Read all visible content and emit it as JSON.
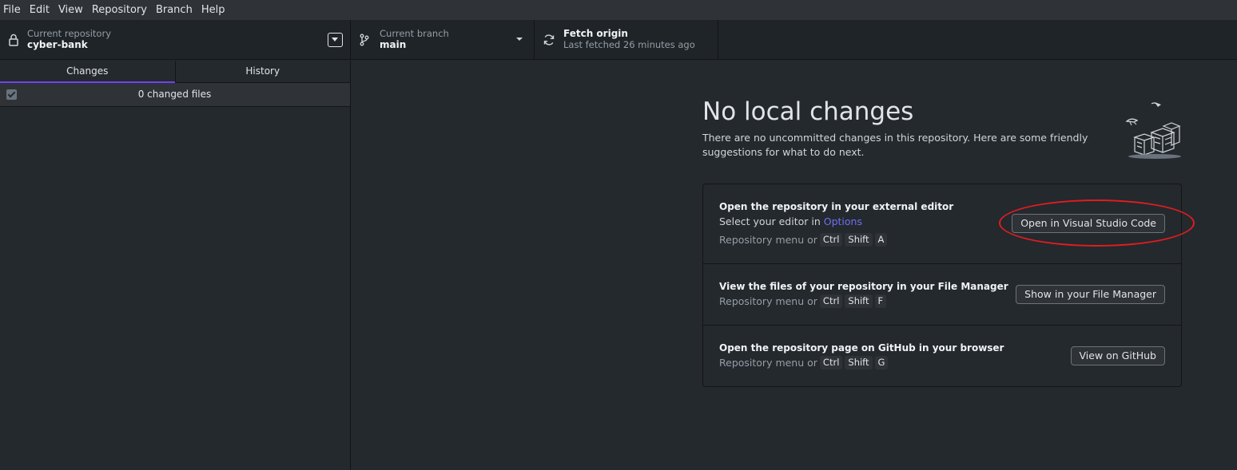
{
  "menu": [
    "File",
    "Edit",
    "View",
    "Repository",
    "Branch",
    "Help"
  ],
  "toolbar": {
    "repo_label": "Current repository",
    "repo_name": "cyber-bank",
    "branch_label": "Current branch",
    "branch_name": "main",
    "fetch_title": "Fetch origin",
    "fetch_status": "Last fetched 26 minutes ago"
  },
  "sidebar": {
    "tabs": [
      {
        "label": "Changes",
        "selected": true
      },
      {
        "label": "History",
        "selected": false
      }
    ],
    "changed_files": "0 changed files"
  },
  "main": {
    "title": "No local changes",
    "description": "There are no uncommitted changes in this repository. Here are some friendly suggestions for what to do next.",
    "suggestions": [
      {
        "title": "Open the repository in your external editor",
        "subtitle_prefix": "Select your editor in ",
        "subtitle_link": "Options",
        "shortcut_prefix": "Repository menu or",
        "keys": [
          "Ctrl",
          "Shift",
          "A"
        ],
        "button": "Open in Visual Studio Code"
      },
      {
        "title": "View the files of your repository in your File Manager",
        "shortcut_prefix": "Repository menu or",
        "keys": [
          "Ctrl",
          "Shift",
          "F"
        ],
        "button": "Show in your File Manager"
      },
      {
        "title": "Open the repository page on GitHub in your browser",
        "shortcut_prefix": "Repository menu or",
        "keys": [
          "Ctrl",
          "Shift",
          "G"
        ],
        "button": "View on GitHub"
      }
    ]
  },
  "colors": {
    "accent_tab": "#6f42f1",
    "link": "#6f6ff5",
    "annotation": "#e11d1d"
  }
}
